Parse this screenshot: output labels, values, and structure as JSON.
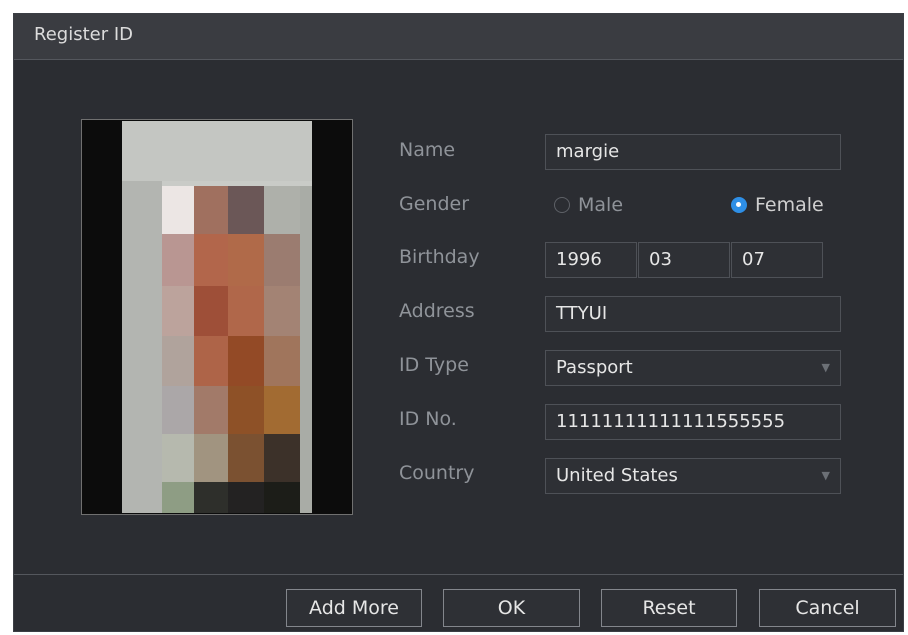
{
  "dialog": {
    "title": "Register ID"
  },
  "form": {
    "name": {
      "label": "Name",
      "value": "margie"
    },
    "gender": {
      "label": "Gender",
      "options": [
        "Male",
        "Female"
      ],
      "selected": "Female"
    },
    "birthday": {
      "label": "Birthday",
      "year": "1996",
      "month": "03",
      "day": "07"
    },
    "address": {
      "label": "Address",
      "value": "TTYUI"
    },
    "id_type": {
      "label": "ID Type",
      "value": "Passport"
    },
    "id_no": {
      "label": "ID No.",
      "value": "11111111111111555555"
    },
    "country": {
      "label": "Country",
      "value": "United States"
    }
  },
  "buttons": {
    "add_more": "Add More",
    "ok": "OK",
    "reset": "Reset",
    "cancel": "Cancel"
  },
  "icons": {
    "dropdown": "chevron-down-icon"
  },
  "colors": {
    "accent": "#2e8fe6",
    "background": "#2b2d32"
  }
}
